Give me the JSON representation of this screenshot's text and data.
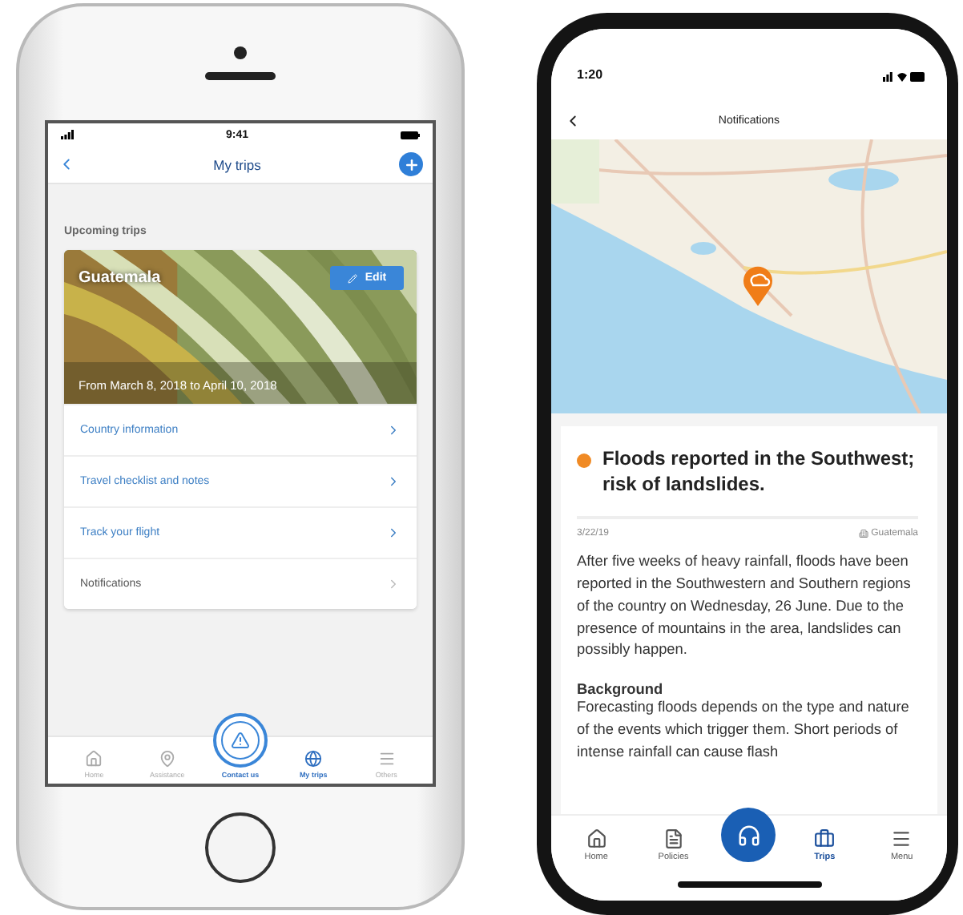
{
  "left_phone": {
    "status_time": "9:41",
    "title": "My trips",
    "section": "Upcoming trips",
    "trip": {
      "name": "Guatemala",
      "edit": "Edit",
      "dates": "From March 8, 2018 to April 10, 2018"
    },
    "rows": [
      {
        "label": "Country information",
        "kind": "link"
      },
      {
        "label": "Travel checklist and notes",
        "kind": "link"
      },
      {
        "label": "Track your flight",
        "kind": "link"
      },
      {
        "label": "Notifications",
        "kind": "muted"
      }
    ],
    "tabs": [
      {
        "label": "Home",
        "kind": "home",
        "selected": false
      },
      {
        "label": "Assistance",
        "kind": "pin",
        "selected": false
      },
      {
        "label": "Contact us",
        "kind": "center",
        "selected": false
      },
      {
        "label": "My trips",
        "kind": "globe",
        "selected": true
      },
      {
        "label": "Others",
        "kind": "menu",
        "selected": false
      }
    ]
  },
  "right_phone": {
    "status_time": "1:20",
    "title": "Notifications",
    "alert": {
      "title": "Floods reported in the Southwest; risk of landslides.",
      "date": "3/22/19",
      "country": "Guatemala",
      "body": "After five weeks of heavy rainfall, floods have been reported in the Southwestern and Southern regions of the country on Wednesday, 26 June. Due to the presence of mountains in the area, landslides can possibly happen.",
      "heading": "Background",
      "body_2": "Forecasting floods depends on the type and nature of the events which trigger them. Short periods of intense rainfall can cause flash"
    },
    "tabs": [
      {
        "label": "Home",
        "kind": "home",
        "selected": false
      },
      {
        "label": "Policies",
        "kind": "doc",
        "selected": false
      },
      {
        "kind": "center",
        "selected": false
      },
      {
        "label": "Trips",
        "kind": "case",
        "selected": true
      },
      {
        "label": "Menu",
        "kind": "menu",
        "selected": false
      }
    ]
  }
}
